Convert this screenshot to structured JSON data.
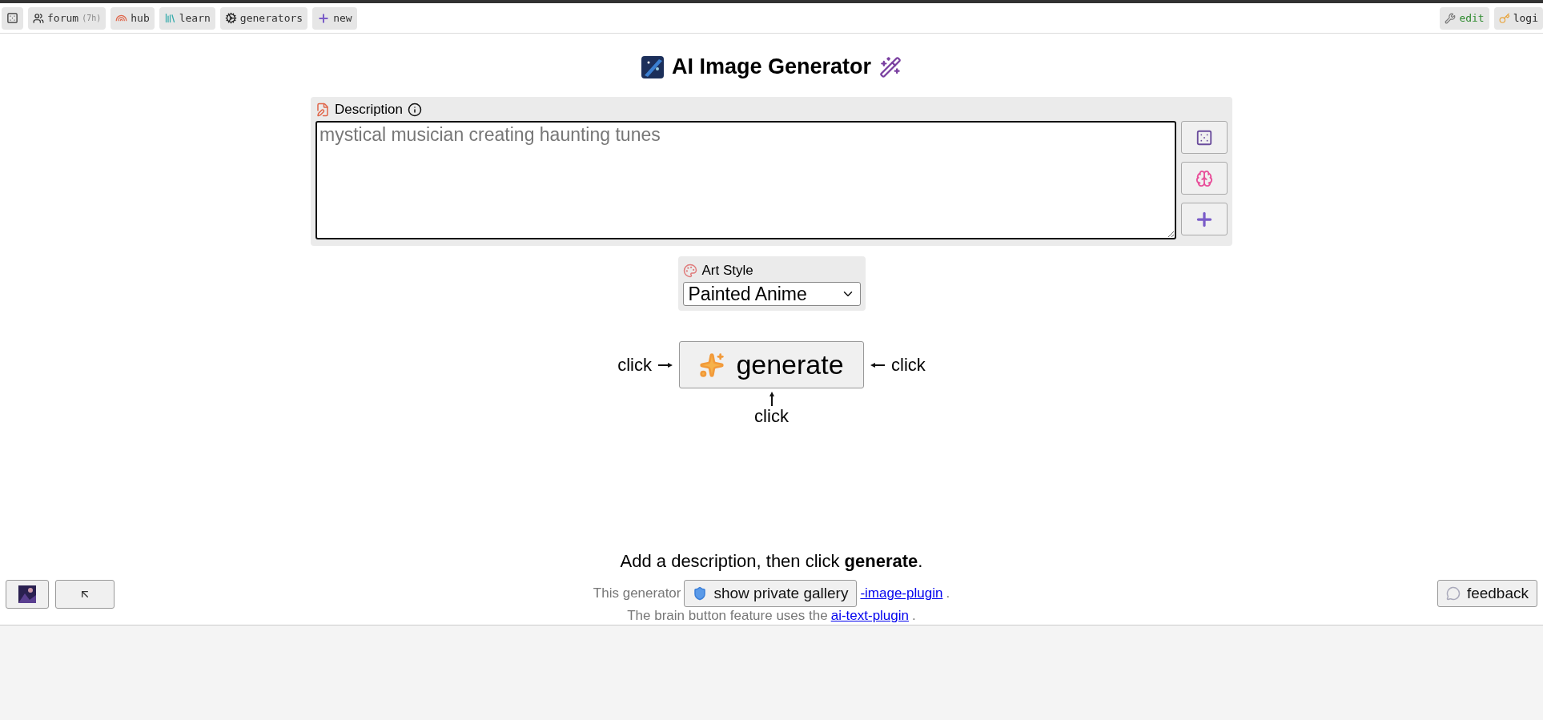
{
  "nav_left": [
    {
      "kind": "icon"
    },
    {
      "kind": "link",
      "label": "forum",
      "badge": "(7h)"
    },
    {
      "kind": "link",
      "label": "hub"
    },
    {
      "kind": "link",
      "label": "learn"
    },
    {
      "kind": "link",
      "label": "generators"
    },
    {
      "kind": "link",
      "label": "new"
    }
  ],
  "nav_right": [
    {
      "label": "edit",
      "color": "#2e8b2e"
    },
    {
      "label": "logi",
      "color": "#222222"
    }
  ],
  "title": "AI Image Generator",
  "description": {
    "label": "Description",
    "value": "mystical musician creating haunting tunes"
  },
  "art_style": {
    "label": "Art Style",
    "value": "Painted Anime"
  },
  "generate": {
    "label": "generate",
    "hints": [
      "click",
      "click",
      "click"
    ]
  },
  "status": "Add a description, then click **generate**.",
  "footer": {
    "line_1_start": "This generator",
    "line_1_link": "-image-plugin",
    "line_1_end": ".",
    "line_2_start": "The brain button feature uses the",
    "line_2_link": "ai-text-plugin",
    "line_2_end": "."
  },
  "gallery_button": "show private gallery",
  "feedback_button": "feedback"
}
